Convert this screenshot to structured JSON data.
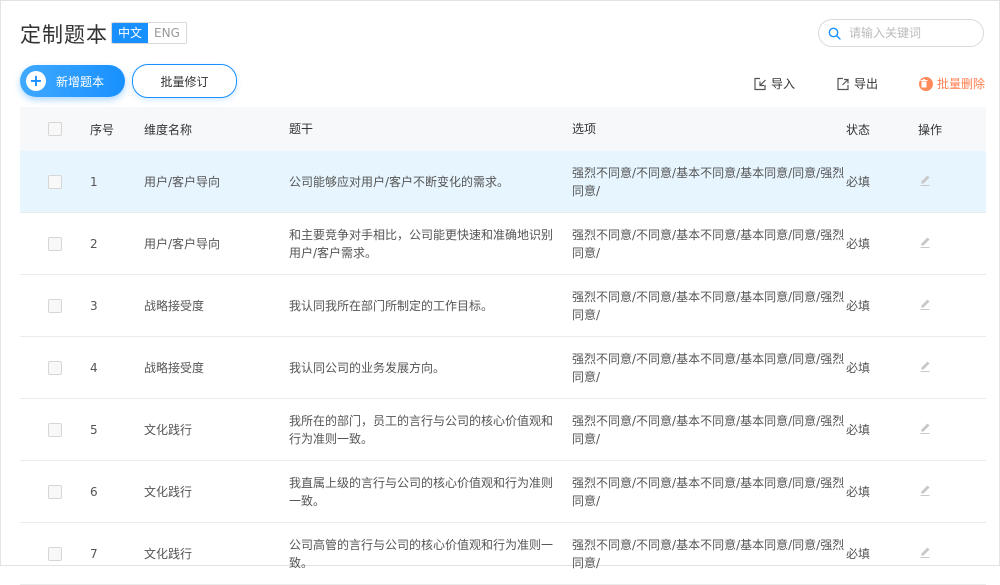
{
  "header": {
    "title": "定制题本",
    "lang_zh": "中文",
    "lang_en": "ENG",
    "search_placeholder": "请输入关键词"
  },
  "actions": {
    "add_label": "新增题本",
    "batch_label": "批量修订",
    "import_label": "导入",
    "export_label": "导出",
    "delete_label": "批量删除"
  },
  "table": {
    "columns": [
      "序号",
      "维度名称",
      "题干",
      "选项",
      "状态",
      "操作"
    ],
    "rows": [
      {
        "no": "1",
        "dim": "用户/客户导向",
        "stem": "公司能够应对用户/客户不断变化的需求。",
        "opt": "强烈不同意/不同意/基本不同意/基本同意/同意/强烈同意/",
        "state": "必填"
      },
      {
        "no": "2",
        "dim": "用户/客户导向",
        "stem": "和主要竞争对手相比，公司能更快速和准确地识别用户/客户需求。",
        "opt": "强烈不同意/不同意/基本不同意/基本同意/同意/强烈同意/",
        "state": "必填"
      },
      {
        "no": "3",
        "dim": "战略接受度",
        "stem": "我认同我所在部门所制定的工作目标。",
        "opt": "强烈不同意/不同意/基本不同意/基本同意/同意/强烈同意/",
        "state": "必填"
      },
      {
        "no": "4",
        "dim": "战略接受度",
        "stem": "我认同公司的业务发展方向。",
        "opt": "强烈不同意/不同意/基本不同意/基本同意/同意/强烈同意/",
        "state": "必填"
      },
      {
        "no": "5",
        "dim": "文化践行",
        "stem": "我所在的部门，员工的言行与公司的核心价值观和行为准则一致。",
        "opt": "强烈不同意/不同意/基本不同意/基本同意/同意/强烈同意/",
        "state": "必填"
      },
      {
        "no": "6",
        "dim": "文化践行",
        "stem": "我直属上级的言行与公司的核心价值观和行为准则一致。",
        "opt": "强烈不同意/不同意/基本不同意/基本同意/同意/强烈同意/",
        "state": "必填"
      },
      {
        "no": "7",
        "dim": "文化践行",
        "stem": "公司高管的言行与公司的核心价值观和行为准则一致。",
        "opt": "强烈不同意/不同意/基本不同意/基本同意/同意/强烈同意/",
        "state": "必填"
      }
    ]
  },
  "colors": {
    "primary": "#1890ff",
    "highlight_row": "#e6f5fe",
    "danger": "#ff7f50",
    "header_bg": "#f7f8fa"
  },
  "icons": {
    "search": "search-icon",
    "add": "plus-icon",
    "import": "import-icon",
    "export": "export-icon",
    "delete": "trash-icon",
    "edit": "pencil-icon"
  }
}
